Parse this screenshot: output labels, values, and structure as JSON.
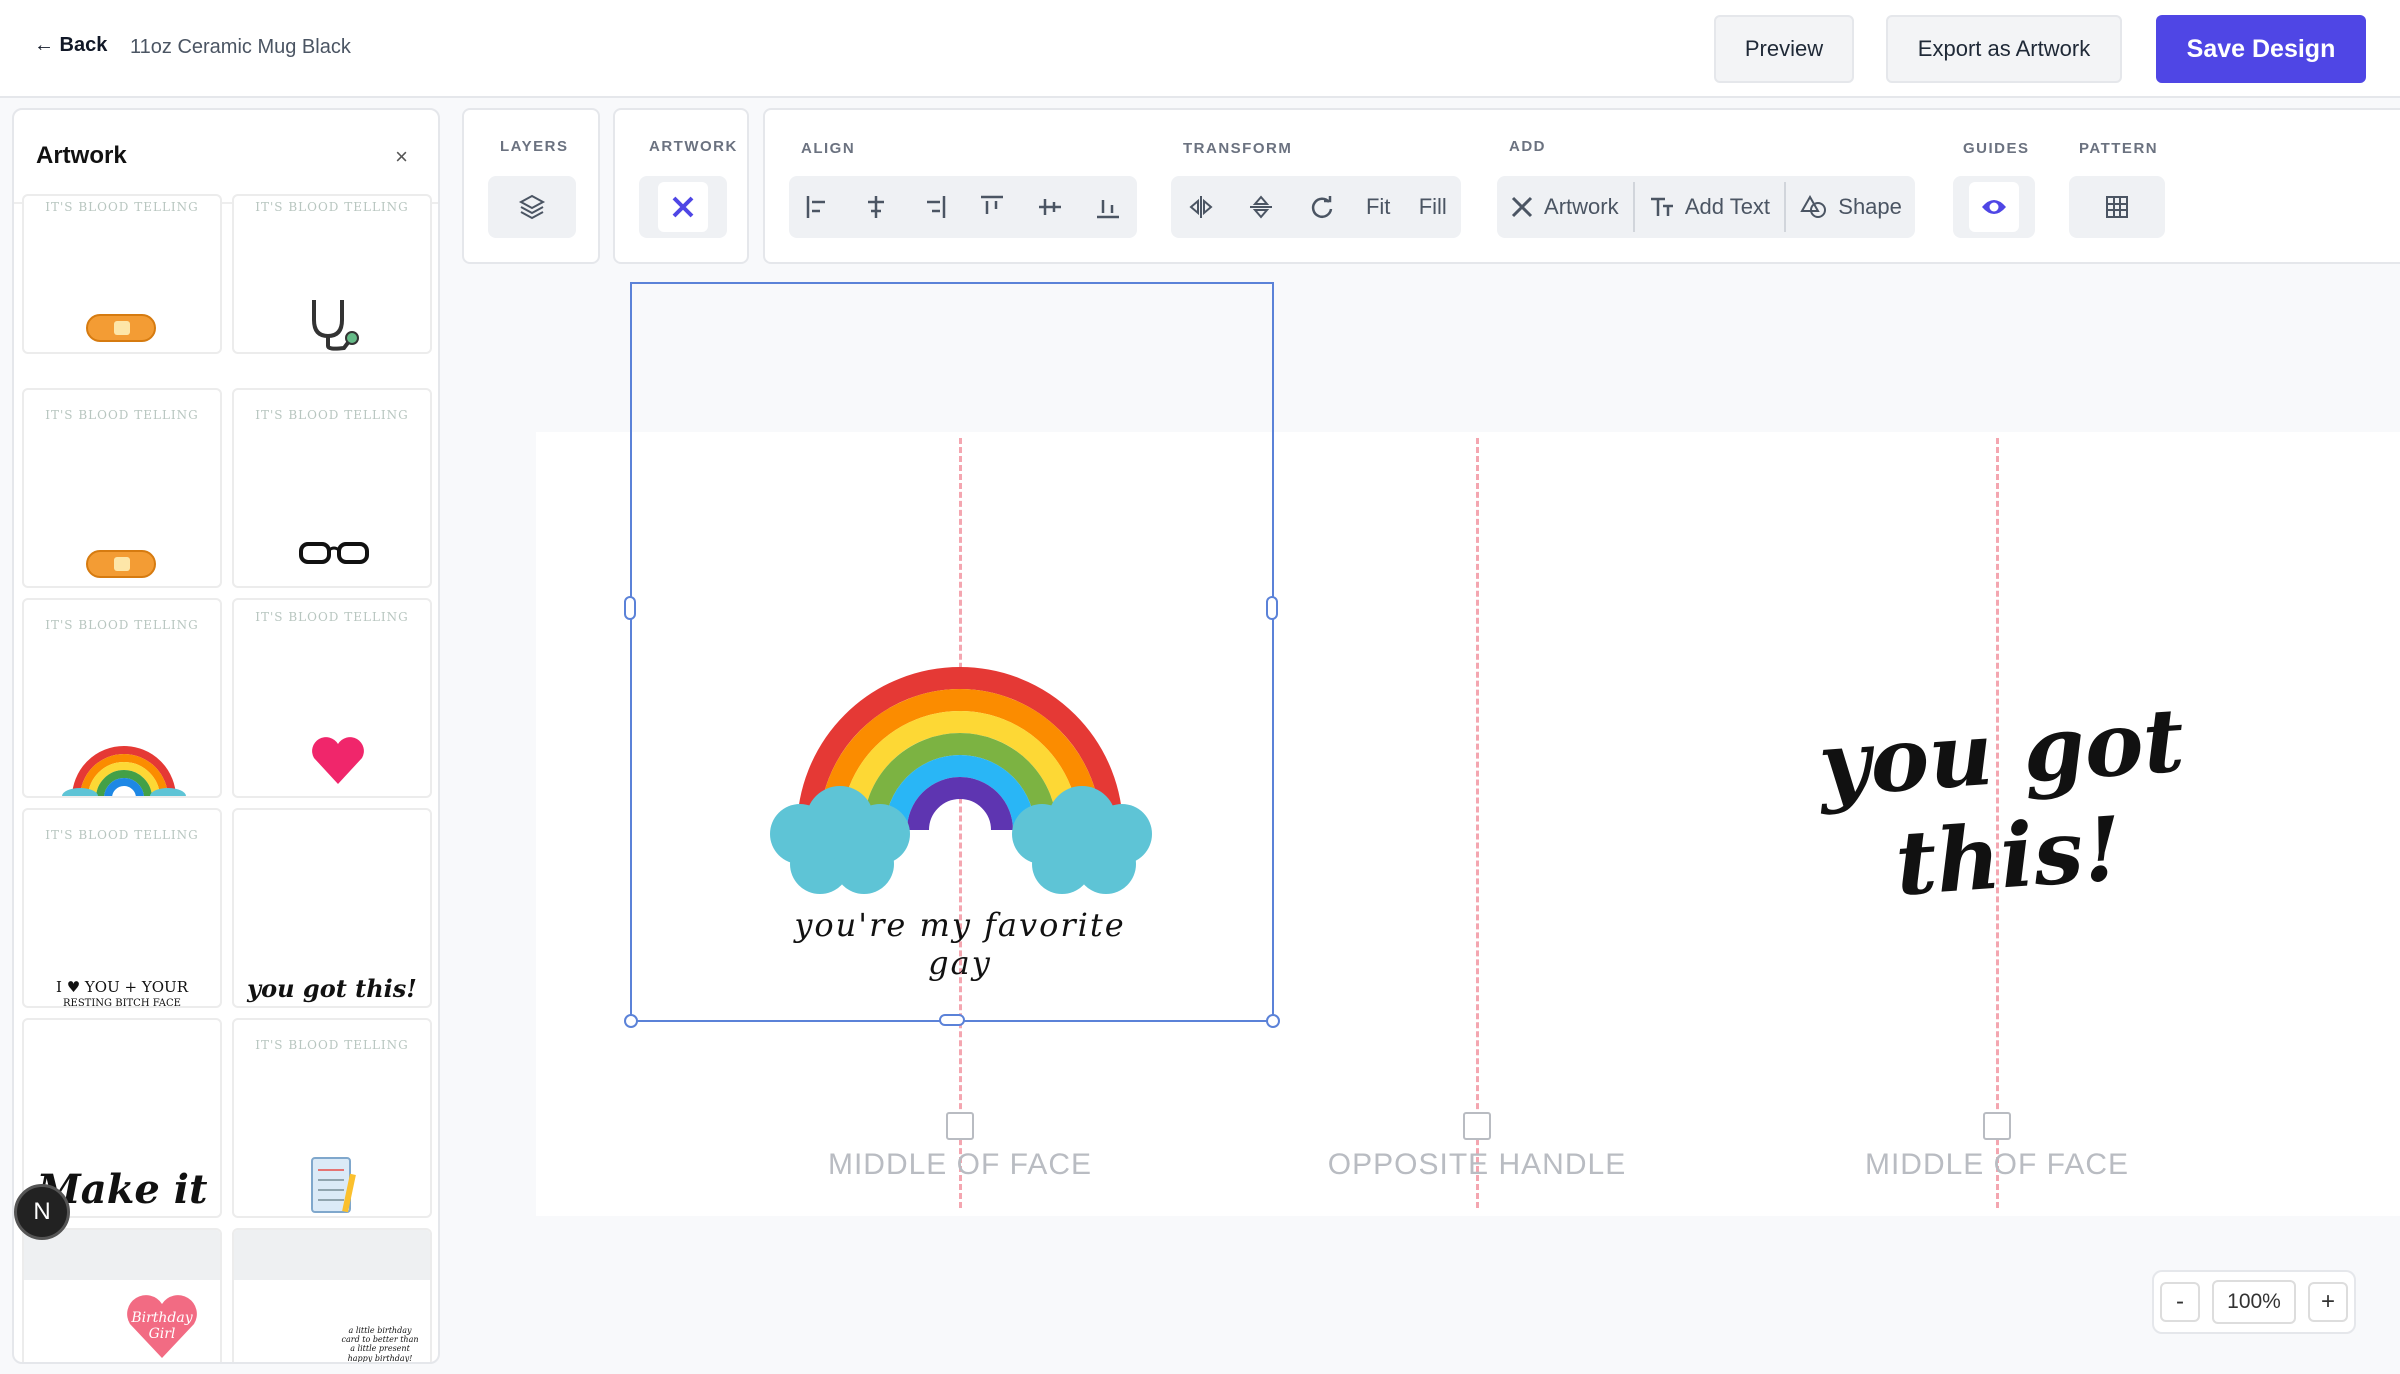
{
  "header": {
    "back_label": "← Back",
    "product": "11oz Ceramic Mug Black",
    "preview": "Preview",
    "export": "Export as Artwork",
    "save": "Save Design"
  },
  "panel": {
    "title": "Artwork",
    "close": "×",
    "tiles": [
      {
        "caption": "IT'S BLOOD TELLING"
      },
      {
        "caption": "IT'S BLOOD TELLING"
      },
      {
        "caption": "IT'S BLOOD TELLING"
      },
      {
        "caption": "IT'S BLOOD TELLING"
      },
      {
        "caption": "IT'S BLOOD TELLING"
      },
      {
        "caption": "IT'S BLOOD TELLING"
      },
      {
        "caption": "IT'S BLOOD TELLING",
        "text": "I ♥ YOU + YOUR",
        "text2": "RESTING BITCH FACE"
      },
      {
        "text": "you got this!"
      },
      {
        "text": "Make it"
      },
      {
        "caption": "IT'S BLOOD TELLING"
      },
      {
        "text": "Birthday Girl"
      },
      {
        "text": "a little birthday card to better than a little present",
        "text2": "happy birthday!"
      }
    ]
  },
  "badge": "N",
  "toolbar": {
    "layers": "LAYERS",
    "artwork": "ARTWORK",
    "align": "ALIGN",
    "transform": "TRANSFORM",
    "add": "ADD",
    "guides": "GUIDES",
    "pattern": "PATTERN",
    "fit": "Fit",
    "fill": "Fill",
    "add_artwork": "Artwork",
    "add_text": "Add Text",
    "add_shape": "Shape"
  },
  "canvas": {
    "rainbow_caption": "you're my favorite gay",
    "right_text": "you got this!",
    "labels": [
      "MIDDLE OF FACE",
      "OPPOSITE HANDLE",
      "MIDDLE OF FACE"
    ]
  },
  "zoom": {
    "minus": "-",
    "value": "100%",
    "plus": "+"
  },
  "colors": {
    "primary": "#4f46e5",
    "guide": "#f4a6b0",
    "selection": "#5b82d8",
    "cloud": "#5ec4d6"
  }
}
